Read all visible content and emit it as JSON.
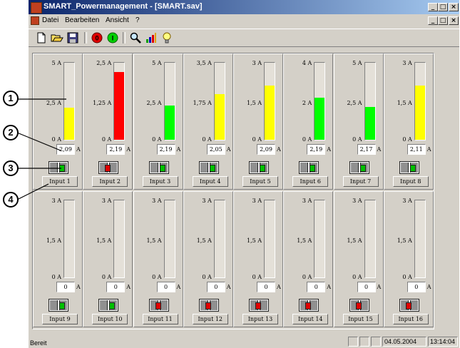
{
  "window": {
    "title": "SMART_Powermanagement - [SMART.sav]"
  },
  "window_buttons": [
    "_",
    "□",
    "×"
  ],
  "menu": [
    "Datei",
    "Bearbeiten",
    "Ansicht",
    "?"
  ],
  "toolbar": [
    {
      "name": "new-file-icon",
      "glyph": "🗋"
    },
    {
      "name": "open-folder-icon",
      "glyph": "📂"
    },
    {
      "name": "save-disk-icon",
      "glyph": "💾"
    },
    {
      "name": "all-off-icon",
      "glyph": "0"
    },
    {
      "name": "all-on-icon",
      "glyph": "I"
    },
    {
      "name": "zoom-icon",
      "glyph": "🔍"
    },
    {
      "name": "bar-chart-icon",
      "glyph": "📊"
    },
    {
      "name": "lightbulb-icon",
      "glyph": "💡"
    }
  ],
  "colors": {
    "yellow": "#ffff00",
    "red": "#ff0000",
    "green": "#00ff00",
    "led_green": "#00c000",
    "led_red": "#e00000",
    "panel": "#d4d0c8"
  },
  "amp_unit": "A",
  "inputs": [
    {
      "label": "Input 1",
      "max": "5 A",
      "mid": "2,5 A",
      "min": "0 A",
      "value": "2,09",
      "level": 0.42,
      "color": "yellow",
      "led": "green"
    },
    {
      "label": "Input 2",
      "max": "2,5 A",
      "mid": "1,25 A",
      "min": "0 A",
      "value": "2,19",
      "level": 0.88,
      "color": "red",
      "led": "red"
    },
    {
      "label": "Input 3",
      "max": "5 A",
      "mid": "2,5 A",
      "min": "0 A",
      "value": "2,19",
      "level": 0.44,
      "color": "green",
      "led": "green"
    },
    {
      "label": "Input 4",
      "max": "3,5 A",
      "mid": "1,75 A",
      "min": "0 A",
      "value": "2,05",
      "level": 0.59,
      "color": "yellow",
      "led": "green"
    },
    {
      "label": "Input 5",
      "max": "3 A",
      "mid": "1,5 A",
      "min": "0 A",
      "value": "2,09",
      "level": 0.7,
      "color": "yellow",
      "led": "green"
    },
    {
      "label": "Input 6",
      "max": "4 A",
      "mid": "2 A",
      "min": "0 A",
      "value": "2,19",
      "level": 0.55,
      "color": "green",
      "led": "green"
    },
    {
      "label": "Input 7",
      "max": "5 A",
      "mid": "2,5 A",
      "min": "0 A",
      "value": "2,17",
      "level": 0.43,
      "color": "green",
      "led": "green"
    },
    {
      "label": "Input 8",
      "max": "3 A",
      "mid": "1,5 A",
      "min": "0 A",
      "value": "2,11",
      "level": 0.7,
      "color": "yellow",
      "led": "green"
    },
    {
      "label": "Input 9",
      "max": "3 A",
      "mid": "1,5 A",
      "min": "0 A",
      "value": "0",
      "level": 0,
      "color": "yellow",
      "led": "green"
    },
    {
      "label": "Input 10",
      "max": "3 A",
      "mid": "1,5 A",
      "min": "0 A",
      "value": "0",
      "level": 0,
      "color": "yellow",
      "led": "green"
    },
    {
      "label": "Input 11",
      "max": "3 A",
      "mid": "1,5 A",
      "min": "0 A",
      "value": "0",
      "level": 0,
      "color": "yellow",
      "led": "red"
    },
    {
      "label": "Input 12",
      "max": "3 A",
      "mid": "1,5 A",
      "min": "0 A",
      "value": "0",
      "level": 0,
      "color": "yellow",
      "led": "red"
    },
    {
      "label": "Input 13",
      "max": "3 A",
      "mid": "1,5 A",
      "min": "0 A",
      "value": "0",
      "level": 0,
      "color": "yellow",
      "led": "red"
    },
    {
      "label": "Input 14",
      "max": "3 A",
      "mid": "1,5 A",
      "min": "0 A",
      "value": "0",
      "level": 0,
      "color": "yellow",
      "led": "red"
    },
    {
      "label": "Input 15",
      "max": "3 A",
      "mid": "1,5 A",
      "min": "0 A",
      "value": "0",
      "level": 0,
      "color": "yellow",
      "led": "red"
    },
    {
      "label": "Input 16",
      "max": "3 A",
      "mid": "1,5 A",
      "min": "0 A",
      "value": "0",
      "level": 0,
      "color": "yellow",
      "led": "red"
    }
  ],
  "status": {
    "ready": "Bereit",
    "date": "04.05.2004",
    "time": "13:14:04"
  },
  "callouts": [
    "1",
    "2",
    "3",
    "4"
  ]
}
